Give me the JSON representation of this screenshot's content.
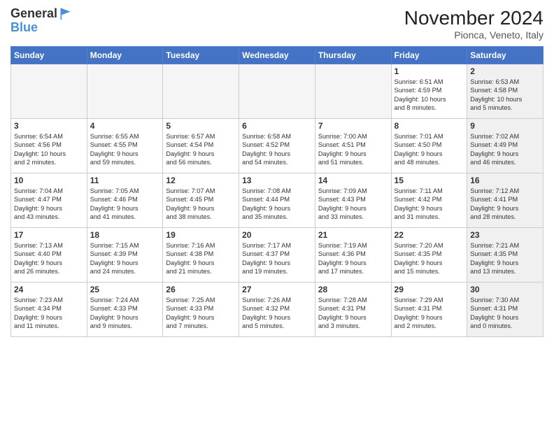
{
  "header": {
    "logo_line1": "General",
    "logo_line2": "Blue",
    "month_title": "November 2024",
    "location": "Pionca, Veneto, Italy"
  },
  "days_of_week": [
    "Sunday",
    "Monday",
    "Tuesday",
    "Wednesday",
    "Thursday",
    "Friday",
    "Saturday"
  ],
  "weeks": [
    [
      {
        "day": "",
        "info": "",
        "empty": true
      },
      {
        "day": "",
        "info": "",
        "empty": true
      },
      {
        "day": "",
        "info": "",
        "empty": true
      },
      {
        "day": "",
        "info": "",
        "empty": true
      },
      {
        "day": "",
        "info": "",
        "empty": true
      },
      {
        "day": "1",
        "info": "Sunrise: 6:51 AM\nSunset: 4:59 PM\nDaylight: 10 hours\nand 8 minutes.",
        "empty": false,
        "shaded": false
      },
      {
        "day": "2",
        "info": "Sunrise: 6:53 AM\nSunset: 4:58 PM\nDaylight: 10 hours\nand 5 minutes.",
        "empty": false,
        "shaded": true
      }
    ],
    [
      {
        "day": "3",
        "info": "Sunrise: 6:54 AM\nSunset: 4:56 PM\nDaylight: 10 hours\nand 2 minutes.",
        "empty": false,
        "shaded": false
      },
      {
        "day": "4",
        "info": "Sunrise: 6:55 AM\nSunset: 4:55 PM\nDaylight: 9 hours\nand 59 minutes.",
        "empty": false,
        "shaded": false
      },
      {
        "day": "5",
        "info": "Sunrise: 6:57 AM\nSunset: 4:54 PM\nDaylight: 9 hours\nand 56 minutes.",
        "empty": false,
        "shaded": false
      },
      {
        "day": "6",
        "info": "Sunrise: 6:58 AM\nSunset: 4:52 PM\nDaylight: 9 hours\nand 54 minutes.",
        "empty": false,
        "shaded": false
      },
      {
        "day": "7",
        "info": "Sunrise: 7:00 AM\nSunset: 4:51 PM\nDaylight: 9 hours\nand 51 minutes.",
        "empty": false,
        "shaded": false
      },
      {
        "day": "8",
        "info": "Sunrise: 7:01 AM\nSunset: 4:50 PM\nDaylight: 9 hours\nand 48 minutes.",
        "empty": false,
        "shaded": false
      },
      {
        "day": "9",
        "info": "Sunrise: 7:02 AM\nSunset: 4:49 PM\nDaylight: 9 hours\nand 46 minutes.",
        "empty": false,
        "shaded": true
      }
    ],
    [
      {
        "day": "10",
        "info": "Sunrise: 7:04 AM\nSunset: 4:47 PM\nDaylight: 9 hours\nand 43 minutes.",
        "empty": false,
        "shaded": false
      },
      {
        "day": "11",
        "info": "Sunrise: 7:05 AM\nSunset: 4:46 PM\nDaylight: 9 hours\nand 41 minutes.",
        "empty": false,
        "shaded": false
      },
      {
        "day": "12",
        "info": "Sunrise: 7:07 AM\nSunset: 4:45 PM\nDaylight: 9 hours\nand 38 minutes.",
        "empty": false,
        "shaded": false
      },
      {
        "day": "13",
        "info": "Sunrise: 7:08 AM\nSunset: 4:44 PM\nDaylight: 9 hours\nand 35 minutes.",
        "empty": false,
        "shaded": false
      },
      {
        "day": "14",
        "info": "Sunrise: 7:09 AM\nSunset: 4:43 PM\nDaylight: 9 hours\nand 33 minutes.",
        "empty": false,
        "shaded": false
      },
      {
        "day": "15",
        "info": "Sunrise: 7:11 AM\nSunset: 4:42 PM\nDaylight: 9 hours\nand 31 minutes.",
        "empty": false,
        "shaded": false
      },
      {
        "day": "16",
        "info": "Sunrise: 7:12 AM\nSunset: 4:41 PM\nDaylight: 9 hours\nand 28 minutes.",
        "empty": false,
        "shaded": true
      }
    ],
    [
      {
        "day": "17",
        "info": "Sunrise: 7:13 AM\nSunset: 4:40 PM\nDaylight: 9 hours\nand 26 minutes.",
        "empty": false,
        "shaded": false
      },
      {
        "day": "18",
        "info": "Sunrise: 7:15 AM\nSunset: 4:39 PM\nDaylight: 9 hours\nand 24 minutes.",
        "empty": false,
        "shaded": false
      },
      {
        "day": "19",
        "info": "Sunrise: 7:16 AM\nSunset: 4:38 PM\nDaylight: 9 hours\nand 21 minutes.",
        "empty": false,
        "shaded": false
      },
      {
        "day": "20",
        "info": "Sunrise: 7:17 AM\nSunset: 4:37 PM\nDaylight: 9 hours\nand 19 minutes.",
        "empty": false,
        "shaded": false
      },
      {
        "day": "21",
        "info": "Sunrise: 7:19 AM\nSunset: 4:36 PM\nDaylight: 9 hours\nand 17 minutes.",
        "empty": false,
        "shaded": false
      },
      {
        "day": "22",
        "info": "Sunrise: 7:20 AM\nSunset: 4:35 PM\nDaylight: 9 hours\nand 15 minutes.",
        "empty": false,
        "shaded": false
      },
      {
        "day": "23",
        "info": "Sunrise: 7:21 AM\nSunset: 4:35 PM\nDaylight: 9 hours\nand 13 minutes.",
        "empty": false,
        "shaded": true
      }
    ],
    [
      {
        "day": "24",
        "info": "Sunrise: 7:23 AM\nSunset: 4:34 PM\nDaylight: 9 hours\nand 11 minutes.",
        "empty": false,
        "shaded": false
      },
      {
        "day": "25",
        "info": "Sunrise: 7:24 AM\nSunset: 4:33 PM\nDaylight: 9 hours\nand 9 minutes.",
        "empty": false,
        "shaded": false
      },
      {
        "day": "26",
        "info": "Sunrise: 7:25 AM\nSunset: 4:33 PM\nDaylight: 9 hours\nand 7 minutes.",
        "empty": false,
        "shaded": false
      },
      {
        "day": "27",
        "info": "Sunrise: 7:26 AM\nSunset: 4:32 PM\nDaylight: 9 hours\nand 5 minutes.",
        "empty": false,
        "shaded": false
      },
      {
        "day": "28",
        "info": "Sunrise: 7:28 AM\nSunset: 4:31 PM\nDaylight: 9 hours\nand 3 minutes.",
        "empty": false,
        "shaded": false
      },
      {
        "day": "29",
        "info": "Sunrise: 7:29 AM\nSunset: 4:31 PM\nDaylight: 9 hours\nand 2 minutes.",
        "empty": false,
        "shaded": false
      },
      {
        "day": "30",
        "info": "Sunrise: 7:30 AM\nSunset: 4:31 PM\nDaylight: 9 hours\nand 0 minutes.",
        "empty": false,
        "shaded": true
      }
    ]
  ]
}
